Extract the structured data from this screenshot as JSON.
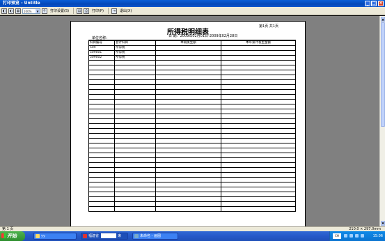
{
  "window": {
    "title": "打印预览 - Untitle",
    "minimize": "_",
    "maximize": "□",
    "close": "×"
  },
  "toolbar": {
    "zoom_value": "100%",
    "print_setup_label": "打印设置(S)",
    "print_label": "打印(P)",
    "exit_label": "退出(X)"
  },
  "report": {
    "page_indicator": "第1页  共1页",
    "title": "所得税明细表",
    "unit_label": "单位名称：",
    "period_label": "日  期：2009年02月01日-2009年02月28日",
    "columns": [
      "科目编号",
      "会计科目",
      "本期发生额",
      "本年累计发生金额"
    ],
    "rows": [
      {
        "code": "509",
        "account": "所得税",
        "period": "",
        "ytd": "",
        "indent": false
      },
      {
        "code": "509001",
        "account": "所得税",
        "period": "",
        "ytd": "",
        "indent": true
      },
      {
        "code": "509002",
        "account": "所得税",
        "period": "",
        "ytd": "",
        "indent": true
      }
    ],
    "empty_row_count": 31
  },
  "status": {
    "page": "第 1 页",
    "size": "210.0 × 297.0mm"
  },
  "taskbar": {
    "start": "开始",
    "items": [
      "yy",
      "福建省",
      "来",
      "未命名 - 画图"
    ],
    "lang": "CH",
    "clock": "15:06"
  }
}
